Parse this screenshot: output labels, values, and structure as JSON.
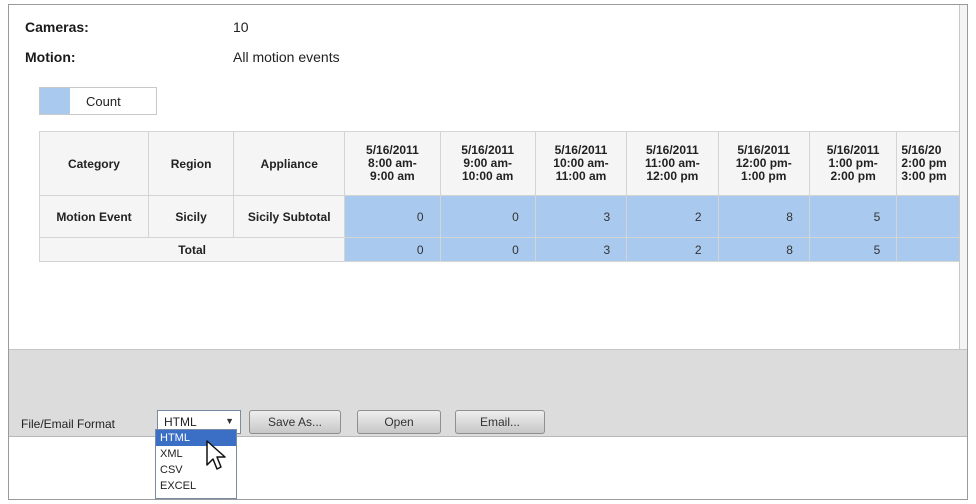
{
  "report": {
    "cameras_label": "Cameras:",
    "cameras_value": "10",
    "motion_label": "Motion:",
    "motion_value": "All motion events",
    "legend_label": "Count",
    "legend_color": "#a9c9ef",
    "columns": {
      "category": "Category",
      "region": "Region",
      "appliance": "Appliance",
      "times": [
        [
          "5/16/2011",
          "8:00 am-",
          "9:00 am"
        ],
        [
          "5/16/2011",
          "9:00 am-",
          "10:00 am"
        ],
        [
          "5/16/2011",
          "10:00 am-",
          "11:00 am"
        ],
        [
          "5/16/2011",
          "11:00 am-",
          "12:00 pm"
        ],
        [
          "5/16/2011",
          "12:00 pm-",
          "1:00 pm"
        ],
        [
          "5/16/2011",
          "1:00 pm-",
          "2:00 pm"
        ],
        [
          "5/16/20",
          "2:00 pm",
          "3:00 pm"
        ]
      ]
    },
    "row1": {
      "category": "Motion Event",
      "region": "Sicily",
      "appliance": "Sicily Subtotal",
      "values": [
        "0",
        "0",
        "3",
        "2",
        "8",
        "5",
        ""
      ]
    },
    "total_row": {
      "label": "Total",
      "values": [
        "0",
        "0",
        "3",
        "2",
        "8",
        "5",
        ""
      ]
    }
  },
  "toolbar": {
    "format_label": "File/Email Format",
    "format_selected": "HTML",
    "save_as": "Save As...",
    "open": "Open",
    "email": "Email..."
  },
  "dropdown": {
    "options": [
      "HTML",
      "XML",
      "CSV",
      "EXCEL"
    ]
  }
}
